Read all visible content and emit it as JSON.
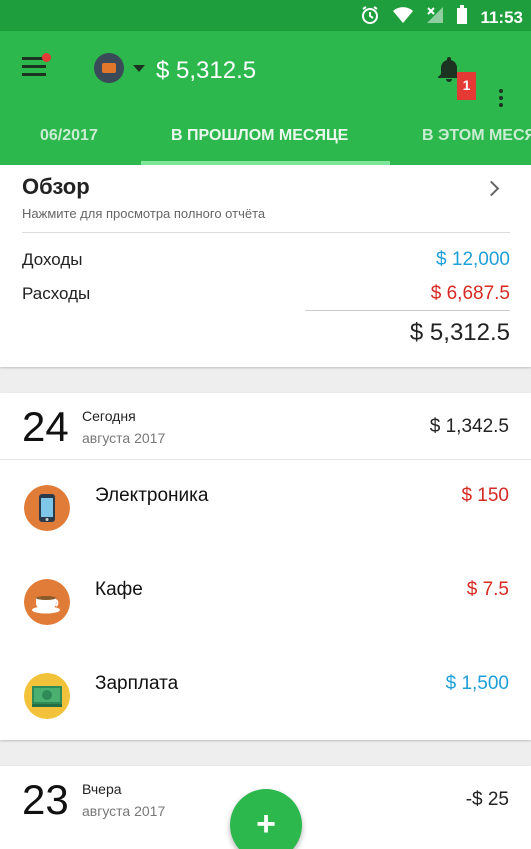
{
  "status_bar": {
    "time": "11:53"
  },
  "app_bar": {
    "balance": "$ 5,312.5",
    "notification_count": "1"
  },
  "tabs": [
    {
      "label": "06/2017",
      "active": false
    },
    {
      "label": "В ПРОШЛОМ МЕСЯЦЕ",
      "active": true
    },
    {
      "label": "В ЭТОМ МЕСЯЦЕ",
      "active": false
    }
  ],
  "overview": {
    "title": "Обзор",
    "subtitle": "Нажмите для просмотра полного отчёта",
    "income_label": "Доходы",
    "income_value": "$ 12,000",
    "expense_label": "Расходы",
    "expense_value": "$ 6,687.5",
    "total": "$ 5,312.5"
  },
  "days": [
    {
      "day": "24",
      "relative": "Сегодня",
      "month_year": "августа 2017",
      "total": "$ 1,342.5",
      "transactions": [
        {
          "name": "Электроника",
          "amount": "$ 150",
          "type": "expense",
          "icon": "phone-icon"
        },
        {
          "name": "Кафе",
          "amount": "$ 7.5",
          "type": "expense",
          "icon": "coffee-cup-icon"
        },
        {
          "name": "Зарплата",
          "amount": "$ 1,500",
          "type": "income",
          "icon": "money-icon"
        }
      ]
    },
    {
      "day": "23",
      "relative": "Вчера",
      "month_year": "августа 2017",
      "total": "-$ 25"
    }
  ],
  "fab": {
    "label": "+"
  },
  "colors": {
    "primary": "#2db84e",
    "status_bar": "#1f9e3e",
    "income": "#1e9fd8",
    "expense": "#d62a24"
  }
}
